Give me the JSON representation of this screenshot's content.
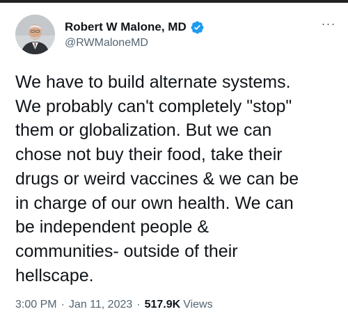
{
  "tweet": {
    "author": {
      "display_name": "Robert W Malone, MD",
      "handle": "@RWMaloneMD",
      "verified": true,
      "verified_icon": "verified-badge-icon",
      "verified_color": "#1d9bf0",
      "avatar_icon": "avatar"
    },
    "more_icon": "more-options-icon",
    "more_label": "···",
    "text": "We have to build alternate systems.\nWe probably can't completely \"stop\"\nthem or globalization. But we can\nchose not buy their food, take their\ndrugs or weird vaccines & we can be\nin charge of our own health. We can\nbe independent people &\ncommunities- outside of their\nhellscape.",
    "time": "3:00 PM",
    "separator": "·",
    "date": "Jan 11, 2023",
    "views_count": "517.9K",
    "views_label": "Views"
  }
}
